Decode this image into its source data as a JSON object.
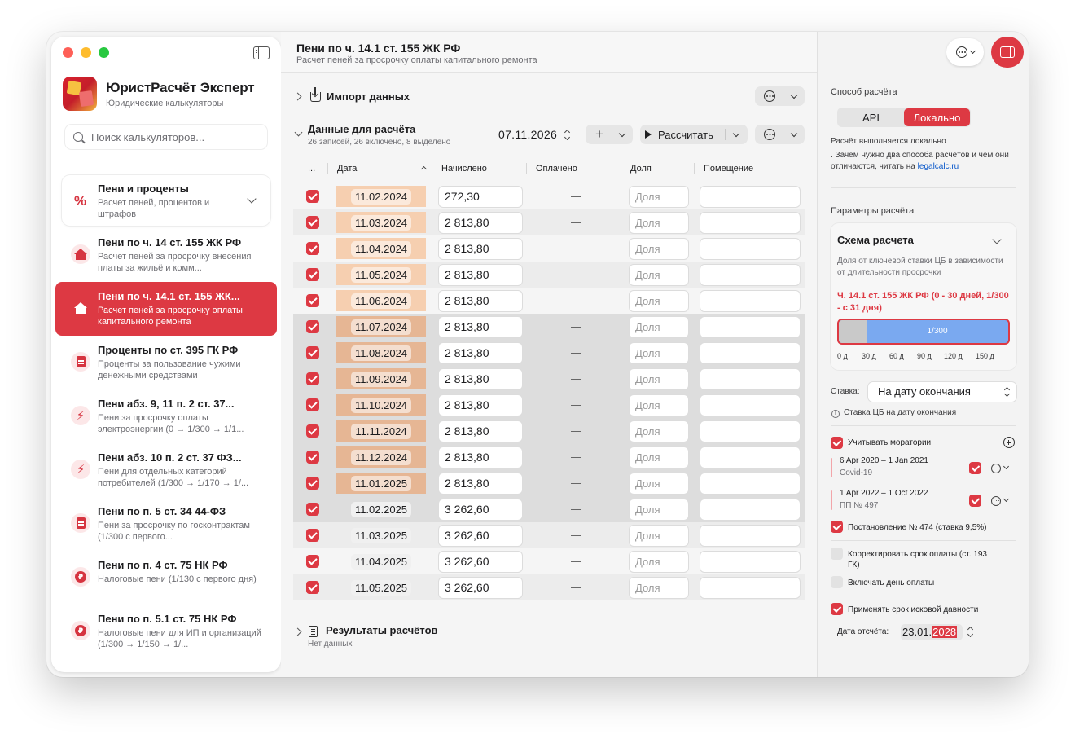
{
  "sidebar": {
    "app_title": "ЮристРасчёт Эксперт",
    "app_subtitle": "Юридические калькуляторы",
    "search_placeholder": "Поиск калькуляторов...",
    "group": {
      "icon": "%",
      "title": "Пени и проценты",
      "description": "Расчет пеней, процентов и штрафов"
    },
    "items": [
      {
        "icon": "house-icon",
        "title": "Пени по ч. 14 ст. 155 ЖК РФ",
        "description": "Расчет пеней за просрочку внесения платы за жильё и комм...",
        "active": false
      },
      {
        "icon": "house-icon",
        "title": "Пени по ч. 14.1 ст. 155 ЖК...",
        "description": "Расчет пеней за просрочку оплаты капитального ремонта",
        "active": true
      },
      {
        "icon": "document-icon",
        "title": "Проценты по ст. 395 ГК РФ",
        "description": "Проценты за пользование чужими денежными средствами",
        "active": false
      },
      {
        "icon": "bolt-icon",
        "title": "Пени абз. 9, 11 п. 2 ст. 37...",
        "description": "Пени за просрочку оплаты электроэнергии (0 → 1/300 → 1/1...",
        "active": false
      },
      {
        "icon": "bolt-icon",
        "title": "Пени абз. 10 п. 2 ст. 37 ФЗ...",
        "description": "Пени для отдельных категорий потребителей (1/300 → 1/170 → 1/...",
        "active": false
      },
      {
        "icon": "document-icon",
        "title": "Пени по п. 5 ст. 34 44-ФЗ",
        "description": "Пени за просрочку по госконтрактам (1/300 с первого...",
        "active": false
      },
      {
        "icon": "ruble-coin-icon",
        "title": "Пени по п. 4 ст. 75 НК РФ",
        "description": "Налоговые пени (1/130 с первого дня)",
        "active": false
      },
      {
        "icon": "ruble-coin-icon",
        "title": "Пени по п. 5.1 ст. 75 НК РФ",
        "description": "Налоговые пени для ИП и организаций (1/300 → 1/150 → 1/...",
        "active": false
      }
    ]
  },
  "main": {
    "title": "Пени по ч. 14.1 ст. 155 ЖК РФ",
    "subtitle": "Расчет пеней за просрочку оплаты капитального ремонта",
    "import_title": "Импорт данных",
    "data_title": "Данные для расчёта",
    "data_subtitle": "26 записей, 26 включено, 8 выделено",
    "calc_date": "07.11.2026",
    "add_label": "+",
    "calculate_label": "Рассчитать",
    "columns": [
      "...",
      "Дата",
      "Начислено",
      "Оплачено",
      "Доля",
      "Помещение"
    ],
    "share_placeholder": "Доля",
    "rows": [
      {
        "date": "11.02.2024",
        "accrued": "272,30",
        "paid": "—",
        "highlight": true,
        "selected": false
      },
      {
        "date": "11.03.2024",
        "accrued": "2 813,80",
        "paid": "—",
        "highlight": true,
        "selected": false
      },
      {
        "date": "11.04.2024",
        "accrued": "2 813,80",
        "paid": "—",
        "highlight": true,
        "selected": false
      },
      {
        "date": "11.05.2024",
        "accrued": "2 813,80",
        "paid": "—",
        "highlight": true,
        "selected": false
      },
      {
        "date": "11.06.2024",
        "accrued": "2 813,80",
        "paid": "—",
        "highlight": true,
        "selected": false
      },
      {
        "date": "11.07.2024",
        "accrued": "2 813,80",
        "paid": "—",
        "highlight": true,
        "selected": true
      },
      {
        "date": "11.08.2024",
        "accrued": "2 813,80",
        "paid": "—",
        "highlight": true,
        "selected": true
      },
      {
        "date": "11.09.2024",
        "accrued": "2 813,80",
        "paid": "—",
        "highlight": true,
        "selected": true
      },
      {
        "date": "11.10.2024",
        "accrued": "2 813,80",
        "paid": "—",
        "highlight": true,
        "selected": true
      },
      {
        "date": "11.11.2024",
        "accrued": "2 813,80",
        "paid": "—",
        "highlight": true,
        "selected": true
      },
      {
        "date": "11.12.2024",
        "accrued": "2 813,80",
        "paid": "—",
        "highlight": true,
        "selected": true
      },
      {
        "date": "11.01.2025",
        "accrued": "2 813,80",
        "paid": "—",
        "highlight": true,
        "selected": true
      },
      {
        "date": "11.02.2025",
        "accrued": "3 262,60",
        "paid": "—",
        "highlight": false,
        "selected": true
      },
      {
        "date": "11.03.2025",
        "accrued": "3 262,60",
        "paid": "—",
        "highlight": false,
        "selected": false
      },
      {
        "date": "11.04.2025",
        "accrued": "3 262,60",
        "paid": "—",
        "highlight": false,
        "selected": false
      },
      {
        "date": "11.05.2025",
        "accrued": "3 262,60",
        "paid": "—",
        "highlight": false,
        "selected": false
      }
    ],
    "results_title": "Результаты расчётов",
    "results_subtitle": "Нет данных"
  },
  "inspector": {
    "method_label": "Способ расчёта",
    "method_options": [
      "API",
      "Локально"
    ],
    "method_selected": "Локально",
    "method_note": "Расчёт выполняется локально",
    "method_note2": ". Зачем нужно два способа расчётов и чем они отличаются, читать на ",
    "method_link": "legalcalc.ru",
    "params_label": "Параметры расчёта",
    "scheme_title": "Схема расчета",
    "scheme_desc": "Доля от ключевой ставки ЦБ в зависимости от длительности просрочки",
    "scheme_rule": "Ч. 14.1 ст. 155 ЖК РФ (0 - 30 дней, 1/300 - с 31 дня)",
    "scale_label": "1/300",
    "scale_ticks": [
      "0 д",
      "30 д",
      "60 д",
      "90 д",
      "120 д",
      "150 д"
    ],
    "rate_label": "Ставка:",
    "rate_value": "На дату окончания",
    "rate_note": "Ставка ЦБ на дату окончания",
    "moratoriums_label": "Учитывать моратории",
    "moratoriums": [
      {
        "period": "6 Apr 2020 – 1 Jan 2021",
        "name": "Covid-19"
      },
      {
        "period": "1 Apr 2022 – 1 Oct 2022",
        "name": "ПП № 497"
      }
    ],
    "decree_label": "Постановление № 474 (ставка 9,5%)",
    "adjust_label": "Корректировать срок оплаты (ст. 193 ГК)",
    "include_day_label": "Включать день оплаты",
    "limitation_label": "Применять срок исковой давности",
    "report_date_label": "Дата отсчёта:",
    "report_date_prefix": "23.01.",
    "report_date_year": "2028"
  },
  "colors": {
    "accent": "#dd3943",
    "highlight": "#f6cfb0",
    "scale_blue": "#7aa9f0"
  }
}
